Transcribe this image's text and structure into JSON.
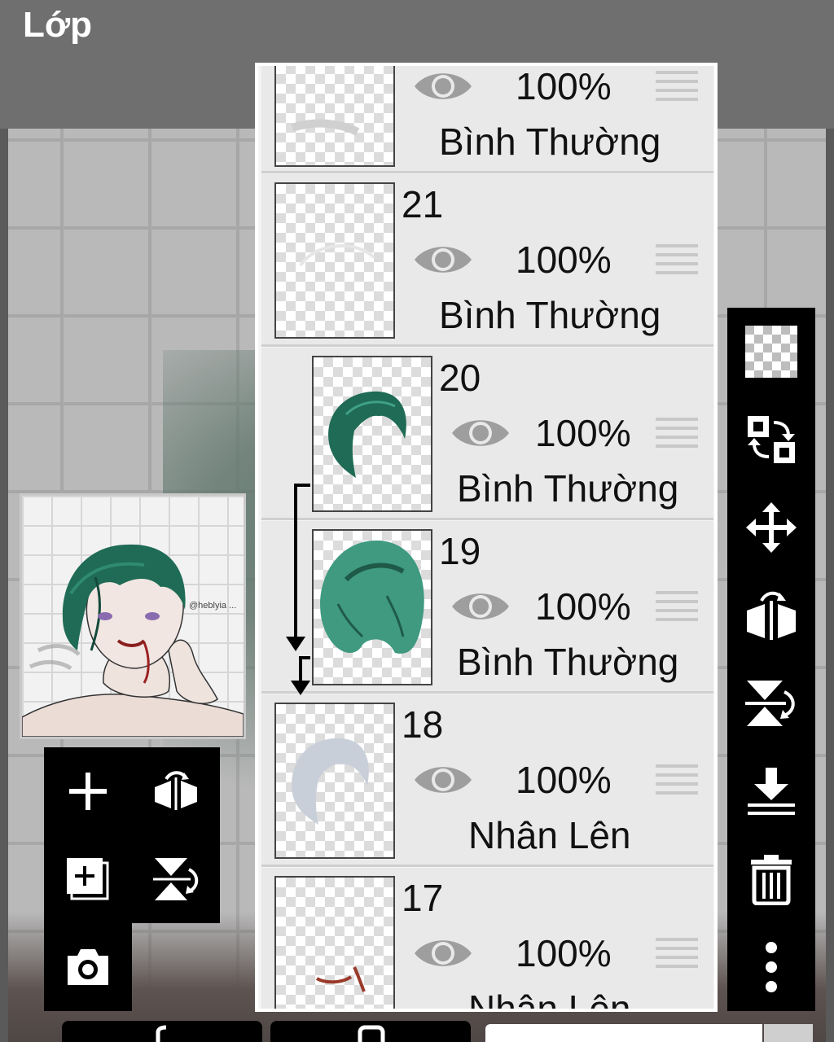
{
  "header": {
    "title": "Lớp"
  },
  "layers": [
    {
      "id": "top",
      "number": "",
      "opacity": "100%",
      "blend": "Bình Thường",
      "visible": true,
      "clipped": false
    },
    {
      "id": "21",
      "number": "21",
      "opacity": "100%",
      "blend": "Bình Thường",
      "visible": true,
      "clipped": false
    },
    {
      "id": "20",
      "number": "20",
      "opacity": "100%",
      "blend": "Bình Thường",
      "visible": true,
      "clipped": true
    },
    {
      "id": "19",
      "number": "19",
      "opacity": "100%",
      "blend": "Bình Thường",
      "visible": true,
      "clipped": true
    },
    {
      "id": "18",
      "number": "18",
      "opacity": "100%",
      "blend": "Nhân Lên",
      "visible": true,
      "clipped": false
    },
    {
      "id": "17",
      "number": "17",
      "opacity": "100%",
      "blend": "Nhân Lên",
      "visible": true,
      "clipped": false
    }
  ],
  "preview": {
    "watermark": "@heblyia ..."
  },
  "left_tools": [
    "add-layer-icon",
    "flip-horizontal-icon",
    "add-copy-layer-icon",
    "flip-vertical-icon",
    "camera-icon"
  ],
  "right_tools": [
    "transparency-icon",
    "swap-layer-icon",
    "move-icon",
    "flip-horizontal-icon",
    "flip-vertical-icon",
    "merge-down-icon",
    "trash-icon",
    "more-icon"
  ],
  "colors": {
    "panel_bg": "#e9e9e9",
    "toolbar_bg": "#000000",
    "hair_teal": "#1f6b55"
  }
}
